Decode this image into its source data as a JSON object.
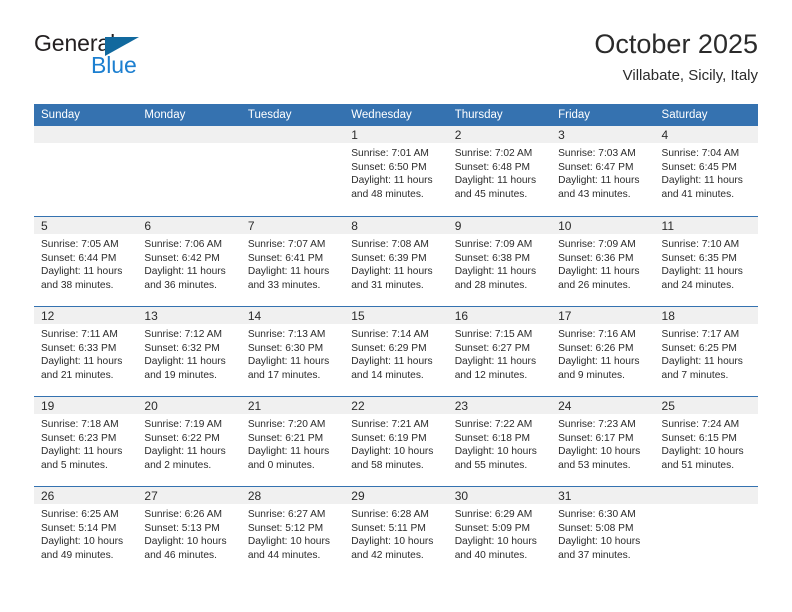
{
  "brand": {
    "name_part1": "General",
    "name_part2": "Blue",
    "triangle_icon": "brand-triangle-icon",
    "color_dark": "#231f20",
    "color_blue": "#1c7fd0",
    "color_triangle": "#11699e"
  },
  "header": {
    "title": "October 2025",
    "subtitle": "Villabate, Sicily, Italy",
    "accent_color": "#3572b0",
    "band_color": "#f0f0f0"
  },
  "weekday_headers": [
    "Sunday",
    "Monday",
    "Tuesday",
    "Wednesday",
    "Thursday",
    "Friday",
    "Saturday"
  ],
  "weeks": [
    [
      {
        "day": "",
        "lines": []
      },
      {
        "day": "",
        "lines": []
      },
      {
        "day": "",
        "lines": []
      },
      {
        "day": "1",
        "lines": [
          "Sunrise: 7:01 AM",
          "Sunset: 6:50 PM",
          "Daylight: 11 hours",
          "and 48 minutes."
        ]
      },
      {
        "day": "2",
        "lines": [
          "Sunrise: 7:02 AM",
          "Sunset: 6:48 PM",
          "Daylight: 11 hours",
          "and 45 minutes."
        ]
      },
      {
        "day": "3",
        "lines": [
          "Sunrise: 7:03 AM",
          "Sunset: 6:47 PM",
          "Daylight: 11 hours",
          "and 43 minutes."
        ]
      },
      {
        "day": "4",
        "lines": [
          "Sunrise: 7:04 AM",
          "Sunset: 6:45 PM",
          "Daylight: 11 hours",
          "and 41 minutes."
        ]
      }
    ],
    [
      {
        "day": "5",
        "lines": [
          "Sunrise: 7:05 AM",
          "Sunset: 6:44 PM",
          "Daylight: 11 hours",
          "and 38 minutes."
        ]
      },
      {
        "day": "6",
        "lines": [
          "Sunrise: 7:06 AM",
          "Sunset: 6:42 PM",
          "Daylight: 11 hours",
          "and 36 minutes."
        ]
      },
      {
        "day": "7",
        "lines": [
          "Sunrise: 7:07 AM",
          "Sunset: 6:41 PM",
          "Daylight: 11 hours",
          "and 33 minutes."
        ]
      },
      {
        "day": "8",
        "lines": [
          "Sunrise: 7:08 AM",
          "Sunset: 6:39 PM",
          "Daylight: 11 hours",
          "and 31 minutes."
        ]
      },
      {
        "day": "9",
        "lines": [
          "Sunrise: 7:09 AM",
          "Sunset: 6:38 PM",
          "Daylight: 11 hours",
          "and 28 minutes."
        ]
      },
      {
        "day": "10",
        "lines": [
          "Sunrise: 7:09 AM",
          "Sunset: 6:36 PM",
          "Daylight: 11 hours",
          "and 26 minutes."
        ]
      },
      {
        "day": "11",
        "lines": [
          "Sunrise: 7:10 AM",
          "Sunset: 6:35 PM",
          "Daylight: 11 hours",
          "and 24 minutes."
        ]
      }
    ],
    [
      {
        "day": "12",
        "lines": [
          "Sunrise: 7:11 AM",
          "Sunset: 6:33 PM",
          "Daylight: 11 hours",
          "and 21 minutes."
        ]
      },
      {
        "day": "13",
        "lines": [
          "Sunrise: 7:12 AM",
          "Sunset: 6:32 PM",
          "Daylight: 11 hours",
          "and 19 minutes."
        ]
      },
      {
        "day": "14",
        "lines": [
          "Sunrise: 7:13 AM",
          "Sunset: 6:30 PM",
          "Daylight: 11 hours",
          "and 17 minutes."
        ]
      },
      {
        "day": "15",
        "lines": [
          "Sunrise: 7:14 AM",
          "Sunset: 6:29 PM",
          "Daylight: 11 hours",
          "and 14 minutes."
        ]
      },
      {
        "day": "16",
        "lines": [
          "Sunrise: 7:15 AM",
          "Sunset: 6:27 PM",
          "Daylight: 11 hours",
          "and 12 minutes."
        ]
      },
      {
        "day": "17",
        "lines": [
          "Sunrise: 7:16 AM",
          "Sunset: 6:26 PM",
          "Daylight: 11 hours",
          "and 9 minutes."
        ]
      },
      {
        "day": "18",
        "lines": [
          "Sunrise: 7:17 AM",
          "Sunset: 6:25 PM",
          "Daylight: 11 hours",
          "and 7 minutes."
        ]
      }
    ],
    [
      {
        "day": "19",
        "lines": [
          "Sunrise: 7:18 AM",
          "Sunset: 6:23 PM",
          "Daylight: 11 hours",
          "and 5 minutes."
        ]
      },
      {
        "day": "20",
        "lines": [
          "Sunrise: 7:19 AM",
          "Sunset: 6:22 PM",
          "Daylight: 11 hours",
          "and 2 minutes."
        ]
      },
      {
        "day": "21",
        "lines": [
          "Sunrise: 7:20 AM",
          "Sunset: 6:21 PM",
          "Daylight: 11 hours",
          "and 0 minutes."
        ]
      },
      {
        "day": "22",
        "lines": [
          "Sunrise: 7:21 AM",
          "Sunset: 6:19 PM",
          "Daylight: 10 hours",
          "and 58 minutes."
        ]
      },
      {
        "day": "23",
        "lines": [
          "Sunrise: 7:22 AM",
          "Sunset: 6:18 PM",
          "Daylight: 10 hours",
          "and 55 minutes."
        ]
      },
      {
        "day": "24",
        "lines": [
          "Sunrise: 7:23 AM",
          "Sunset: 6:17 PM",
          "Daylight: 10 hours",
          "and 53 minutes."
        ]
      },
      {
        "day": "25",
        "lines": [
          "Sunrise: 7:24 AM",
          "Sunset: 6:15 PM",
          "Daylight: 10 hours",
          "and 51 minutes."
        ]
      }
    ],
    [
      {
        "day": "26",
        "lines": [
          "Sunrise: 6:25 AM",
          "Sunset: 5:14 PM",
          "Daylight: 10 hours",
          "and 49 minutes."
        ]
      },
      {
        "day": "27",
        "lines": [
          "Sunrise: 6:26 AM",
          "Sunset: 5:13 PM",
          "Daylight: 10 hours",
          "and 46 minutes."
        ]
      },
      {
        "day": "28",
        "lines": [
          "Sunrise: 6:27 AM",
          "Sunset: 5:12 PM",
          "Daylight: 10 hours",
          "and 44 minutes."
        ]
      },
      {
        "day": "29",
        "lines": [
          "Sunrise: 6:28 AM",
          "Sunset: 5:11 PM",
          "Daylight: 10 hours",
          "and 42 minutes."
        ]
      },
      {
        "day": "30",
        "lines": [
          "Sunrise: 6:29 AM",
          "Sunset: 5:09 PM",
          "Daylight: 10 hours",
          "and 40 minutes."
        ]
      },
      {
        "day": "31",
        "lines": [
          "Sunrise: 6:30 AM",
          "Sunset: 5:08 PM",
          "Daylight: 10 hours",
          "and 37 minutes."
        ]
      },
      {
        "day": "",
        "lines": []
      }
    ]
  ]
}
